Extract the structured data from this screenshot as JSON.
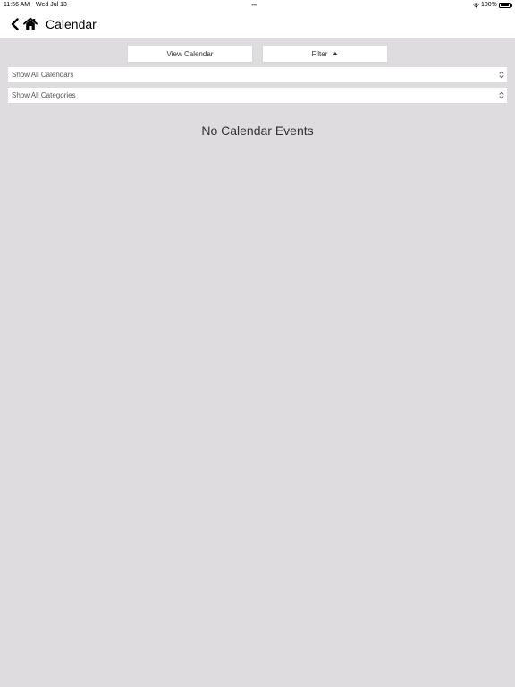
{
  "status_bar": {
    "time": "11:56 AM",
    "date": "Wed Jul 13",
    "battery": "100%"
  },
  "nav": {
    "title": "Calendar"
  },
  "segment": {
    "view_calendar": "View Calendar",
    "filter": "Filter"
  },
  "filters": {
    "calendars": "Show All Calendars",
    "categories": "Show All Categories"
  },
  "main": {
    "empty_message": "No Calendar Events"
  },
  "colors": {
    "background": "#dedcdf",
    "nav_divider": "#6f5f72"
  },
  "icons": {
    "back": "chevron-left-icon",
    "home": "home-icon",
    "filter_caret": "caret-up-icon",
    "select_indicator": "updown-chevron-icon"
  }
}
